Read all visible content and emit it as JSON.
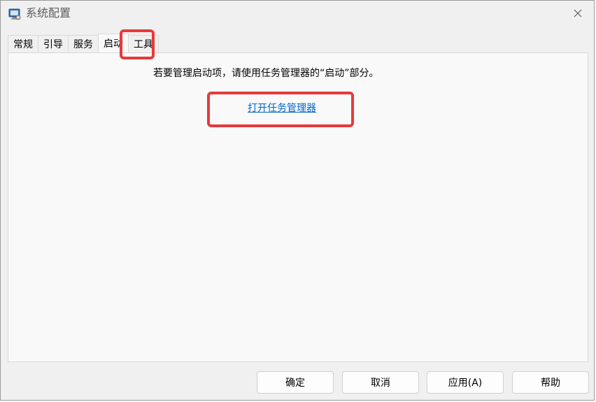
{
  "window": {
    "title": "系统配置"
  },
  "tabs": [
    {
      "label": "常规"
    },
    {
      "label": "引导"
    },
    {
      "label": "服务"
    },
    {
      "label": "启动",
      "active": true
    },
    {
      "label": "工具"
    }
  ],
  "startup": {
    "info": "若要管理启动项，请使用任务管理器的“启动”部分。",
    "link": "打开任务管理器"
  },
  "buttons": {
    "ok": "确定",
    "cancel": "取消",
    "apply": "应用(A)",
    "help": "帮助"
  },
  "colors": {
    "highlight": "#e8393a",
    "link": "#0066cc"
  }
}
